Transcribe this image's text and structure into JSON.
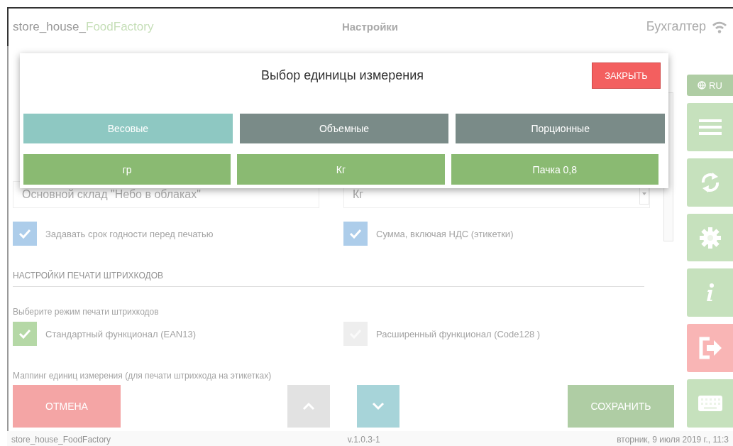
{
  "header": {
    "app_name_prefix": "store_house_",
    "app_name_suffix": "FoodFactory",
    "title": "Настройки",
    "user": "Бухгалтер"
  },
  "sidebar": {
    "language": "RU",
    "buttons": [
      {
        "kind": "menu"
      },
      {
        "kind": "sync"
      },
      {
        "kind": "settings"
      },
      {
        "kind": "info"
      },
      {
        "kind": "logout"
      },
      {
        "kind": "keyboard"
      }
    ]
  },
  "form": {
    "warehouse_field": {
      "value": "Основной склад \"Небо в облаках\""
    },
    "unit_select": {
      "value": "Кг"
    },
    "checkboxes": [
      {
        "label": "Задавать срок годности перед печатью",
        "checked": true
      },
      {
        "label": "Сумма, включая НДС (этикетки)",
        "checked": true
      }
    ],
    "section_title": "НАСТРОЙКИ ПЕЧАТИ ШТРИХКОДОВ",
    "barcode_mode_label": "Выберите режим печати штрихкодов",
    "barcode_modes": [
      {
        "label": "Стандартный функционал (EAN13)",
        "selected": true
      },
      {
        "label": "Расширенный функционал (Code128 )",
        "selected": false
      }
    ],
    "mapping_label": "Маппинг единиц измерения (для печати штрихкода на этикетках)"
  },
  "actions": {
    "cancel": "ОТМЕНА",
    "scroll_buttons": [
      {
        "kind": "up",
        "disabled": true
      },
      {
        "kind": "down",
        "disabled": false
      }
    ],
    "save": "СОХРАНИТЬ"
  },
  "modal": {
    "title": "Выбор единицы измерения",
    "close_button": "ЗАКРЫТЬ",
    "categories": [
      {
        "label": "Весовые",
        "selected": true
      },
      {
        "label": "Объемные",
        "selected": false
      },
      {
        "label": "Порционные",
        "selected": false
      }
    ],
    "units": [
      {
        "label": "гр"
      },
      {
        "label": "Кг"
      },
      {
        "label": "Пачка 0,8"
      }
    ]
  },
  "status_bar": {
    "left": "store_house_FoodFactory",
    "center": "v.1.0.3-1",
    "right": "вторник, 9 июля 2019 г., 11:3"
  }
}
